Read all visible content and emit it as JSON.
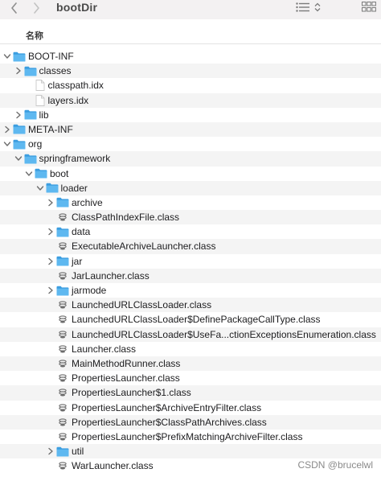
{
  "window": {
    "title": "bootDir"
  },
  "toolbar": {
    "back_icon": "chevron-left-icon",
    "forward_icon": "chevron-right-icon",
    "list_view_icon": "list-view-icon",
    "grid_view_icon": "grid-view-icon"
  },
  "header": {
    "name_column": "名称"
  },
  "colors": {
    "folder": "#5eb8f0",
    "folder_dark": "#3c9ee0",
    "alt_row": "#f4f4f4"
  },
  "tree": [
    {
      "name": "BOOT-INF",
      "type": "folder",
      "depth": 0,
      "expanded": true
    },
    {
      "name": "classes",
      "type": "folder",
      "depth": 1,
      "expanded": false
    },
    {
      "name": "classpath.idx",
      "type": "file",
      "depth": 1
    },
    {
      "name": "layers.idx",
      "type": "file",
      "depth": 1
    },
    {
      "name": "lib",
      "type": "folder",
      "depth": 1,
      "expanded": false
    },
    {
      "name": "META-INF",
      "type": "folder",
      "depth": 0,
      "expanded": false
    },
    {
      "name": "org",
      "type": "folder",
      "depth": 0,
      "expanded": true
    },
    {
      "name": "springframework",
      "type": "folder",
      "depth": 1,
      "expanded": true
    },
    {
      "name": "boot",
      "type": "folder",
      "depth": 2,
      "expanded": true
    },
    {
      "name": "loader",
      "type": "folder",
      "depth": 3,
      "expanded": true
    },
    {
      "name": "archive",
      "type": "folder",
      "depth": 4,
      "expanded": false
    },
    {
      "name": "ClassPathIndexFile.class",
      "type": "class",
      "depth": 4
    },
    {
      "name": "data",
      "type": "folder",
      "depth": 4,
      "expanded": false
    },
    {
      "name": "ExecutableArchiveLauncher.class",
      "type": "class",
      "depth": 4
    },
    {
      "name": "jar",
      "type": "folder",
      "depth": 4,
      "expanded": false
    },
    {
      "name": "JarLauncher.class",
      "type": "class",
      "depth": 4
    },
    {
      "name": "jarmode",
      "type": "folder",
      "depth": 4,
      "expanded": false
    },
    {
      "name": "LaunchedURLClassLoader.class",
      "type": "class",
      "depth": 4
    },
    {
      "name": "LaunchedURLClassLoader$DefinePackageCallType.class",
      "type": "class",
      "depth": 4
    },
    {
      "name": "LaunchedURLClassLoader$UseFa...ctionExceptionsEnumeration.class",
      "type": "class",
      "depth": 4
    },
    {
      "name": "Launcher.class",
      "type": "class",
      "depth": 4
    },
    {
      "name": "MainMethodRunner.class",
      "type": "class",
      "depth": 4
    },
    {
      "name": "PropertiesLauncher.class",
      "type": "class",
      "depth": 4
    },
    {
      "name": "PropertiesLauncher$1.class",
      "type": "class",
      "depth": 4
    },
    {
      "name": "PropertiesLauncher$ArchiveEntryFilter.class",
      "type": "class",
      "depth": 4
    },
    {
      "name": "PropertiesLauncher$ClassPathArchives.class",
      "type": "class",
      "depth": 4
    },
    {
      "name": "PropertiesLauncher$PrefixMatchingArchiveFilter.class",
      "type": "class",
      "depth": 4
    },
    {
      "name": "util",
      "type": "folder",
      "depth": 4,
      "expanded": false
    },
    {
      "name": "WarLauncher.class",
      "type": "class",
      "depth": 4
    }
  ],
  "watermark": "CSDN @brucelwl"
}
